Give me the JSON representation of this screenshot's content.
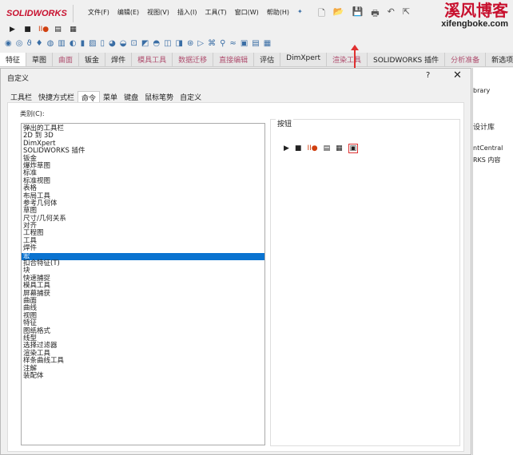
{
  "app": {
    "logo": "SOLIDWORKS",
    "menu": [
      "文件(F)",
      "编辑(E)",
      "视图(V)",
      "插入(I)",
      "工具(T)",
      "窗口(W)",
      "帮助(H)"
    ],
    "pin": "✦",
    "quick": [
      "🗋",
      "📂",
      "💾",
      "🖶",
      "↶",
      "⇱"
    ]
  },
  "watermark": {
    "title": "溪风博客",
    "url": "xifengboke.com"
  },
  "macro_toolbar": [
    "▶",
    "■",
    "II●",
    "▤",
    "▦"
  ],
  "icon_toolbar": [
    "◉",
    "◎",
    "ϑ",
    "♦",
    "◍",
    "▥",
    "◐",
    "▮",
    "▨",
    "▯",
    "◕",
    "◒",
    "⊡",
    "◩",
    "◓",
    "◫",
    "◨",
    "⊛",
    "▷",
    "⌘",
    "⚲",
    "≈",
    "▣",
    "▤",
    "▦"
  ],
  "ribbon_tabs": [
    {
      "label": "特征"
    },
    {
      "label": "草图"
    },
    {
      "label": "曲面",
      "m": true
    },
    {
      "label": "钣金"
    },
    {
      "label": "焊件"
    },
    {
      "label": "模具工具",
      "m": true
    },
    {
      "label": "数据迁移",
      "m": true
    },
    {
      "label": "直接编辑",
      "m": true
    },
    {
      "label": "评估"
    },
    {
      "label": "DimXpert"
    },
    {
      "label": "渲染工具",
      "m": true
    },
    {
      "label": "SOLIDWORKS 插件"
    },
    {
      "label": "分析准备",
      "m": true
    },
    {
      "label": "新选项"
    }
  ],
  "dialog": {
    "title": "自定义",
    "help": "?",
    "close": "✕",
    "tabs": [
      "工具栏",
      "快捷方式栏",
      "命令",
      "菜单",
      "键盘",
      "鼠标笔势",
      "自定义"
    ],
    "active_tab": 2,
    "category_label": "类别(C):",
    "categories": [
      "弹出的工具栏",
      "2D 到 3D",
      "DimXpert",
      "SOLIDWORKS 插件",
      "钣金",
      "爆炸草图",
      "标准",
      "标准视图",
      "表格",
      "布局工具",
      "参考几何体",
      "草图",
      "尺寸/几何关系",
      "对齐",
      "工程图",
      "工具",
      "焊件",
      "宏",
      "扣合特征(T)",
      "块",
      "快速捕捉",
      "模具工具",
      "屏幕捕获",
      "曲面",
      "曲线",
      "视图",
      "特征",
      "图纸格式",
      "线型",
      "选择过滤器",
      "渲染工具",
      "样条曲线工具",
      "注解",
      "装配体"
    ],
    "selected_category": "宏",
    "buttons_label": "按钮",
    "buttons": [
      "▶",
      "■",
      "II●",
      "▤",
      "▦",
      "▣"
    ]
  },
  "side_panel": [
    "brary",
    "设计库",
    "ntCentral",
    "RKS 内容"
  ]
}
